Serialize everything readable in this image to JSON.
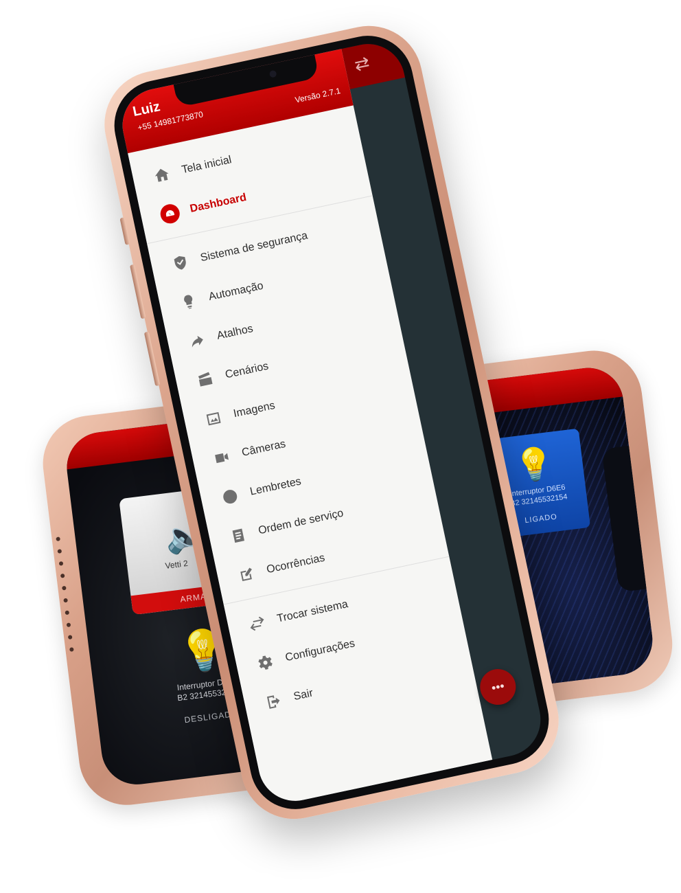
{
  "drawer": {
    "user_name": "Luiz",
    "user_phone": "+55 14981773870",
    "version": "Versão 2.7.1"
  },
  "menu": {
    "group1": [
      {
        "label": "Tela inicial",
        "icon": "home-icon"
      },
      {
        "label": "Dashboard",
        "icon": "dashboard-icon",
        "active": true
      }
    ],
    "group2": [
      {
        "label": "Sistema de segurança",
        "icon": "shield-icon"
      },
      {
        "label": "Automação",
        "icon": "bulb-icon"
      },
      {
        "label": "Atalhos",
        "icon": "share-arrow-icon"
      },
      {
        "label": "Cenários",
        "icon": "clapperboard-icon"
      },
      {
        "label": "Imagens",
        "icon": "image-icon"
      },
      {
        "label": "Câmeras",
        "icon": "video-camera-icon"
      },
      {
        "label": "Lembretes",
        "icon": "clock-icon"
      },
      {
        "label": "Ordem de serviço",
        "icon": "document-icon"
      },
      {
        "label": "Ocorrências",
        "icon": "edit-icon"
      }
    ],
    "group3": [
      {
        "label": "Trocar sistema",
        "icon": "swap-icon"
      },
      {
        "label": "Configurações",
        "icon": "gear-icon"
      },
      {
        "label": "Sair",
        "icon": "exit-icon"
      }
    ]
  },
  "fab": {
    "label": "•••"
  },
  "left_phone": {
    "alarm_label": "Vetti 2",
    "alarm_status": "ARMAD",
    "switch_name_line1": "Interruptor D6E6",
    "switch_name_line2": "B2 32145532154",
    "switch_state": "DESLIGADO"
  },
  "right_phone": {
    "switch_name_line1": "Interruptor D6E6",
    "switch_name_line2": "B2 32145532154",
    "switch_state": "LIGADO"
  },
  "colors": {
    "brand_red": "#d10000",
    "drawer_bg": "#f6f6f4",
    "screen_bg": "#243136",
    "switch_on_blue": "#1f64d6"
  }
}
